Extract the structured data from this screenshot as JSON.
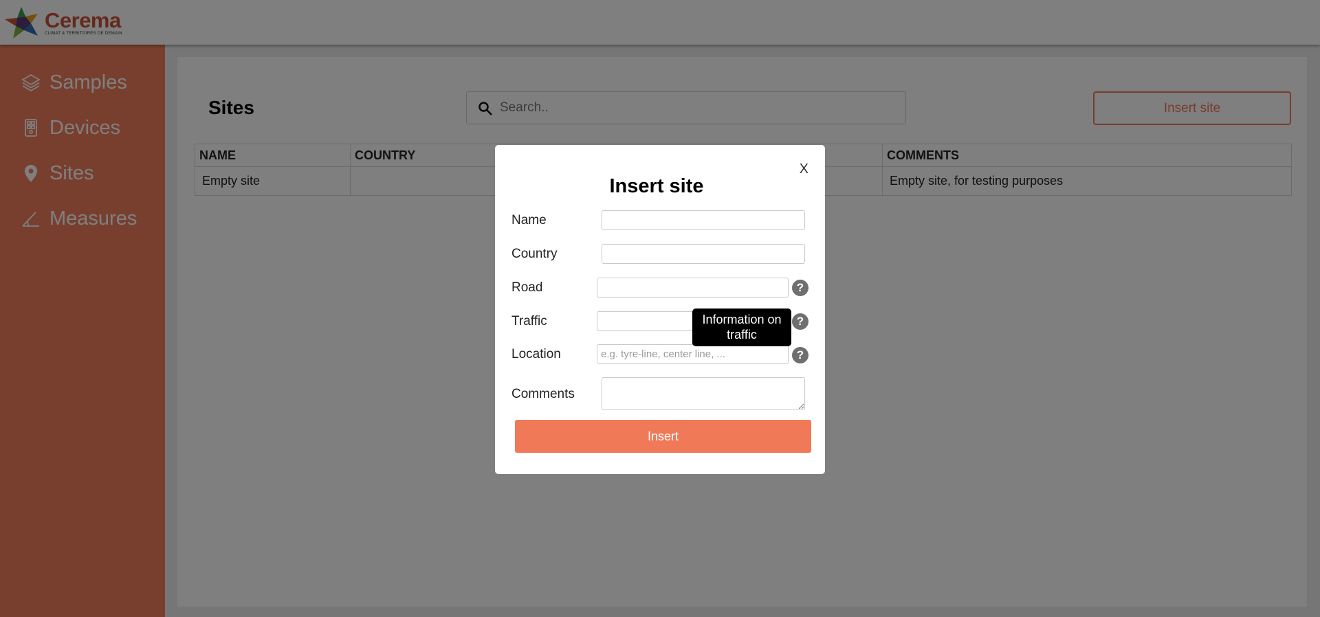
{
  "brand": {
    "name": "Cerema",
    "tagline": "CLIMAT & TERRITOIRES DE DEMAIN",
    "accent": "#f07f5e"
  },
  "sidebar": {
    "items": [
      {
        "label": "Samples",
        "icon": "layers-icon"
      },
      {
        "label": "Devices",
        "icon": "device-icon"
      },
      {
        "label": "Sites",
        "icon": "map-pin-icon"
      },
      {
        "label": "Measures",
        "icon": "angle-icon"
      }
    ]
  },
  "page": {
    "title": "Sites",
    "search_placeholder": "Search..",
    "insert_button": "Insert site"
  },
  "table": {
    "columns": [
      "NAME",
      "COUNTRY",
      "",
      "COMMENTS"
    ],
    "rows": [
      [
        "Empty site",
        "",
        "",
        "Empty site, for testing purposes"
      ]
    ]
  },
  "modal": {
    "title": "Insert site",
    "close": "X",
    "fields": {
      "name": "Name",
      "country": "Country",
      "road": "Road",
      "traffic": "Traffic",
      "location": "Location",
      "location_placeholder": "e.g. tyre-line, center line, ...",
      "comments": "Comments"
    },
    "help_glyph": "?",
    "tooltip": "Information on traffic",
    "submit": "Insert"
  }
}
